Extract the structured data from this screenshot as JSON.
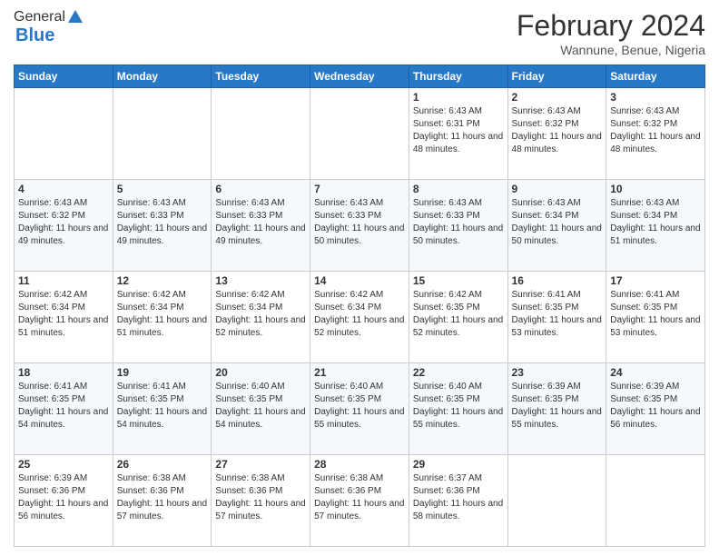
{
  "logo": {
    "general": "General",
    "blue": "Blue"
  },
  "header": {
    "title": "February 2024",
    "subtitle": "Wannune, Benue, Nigeria"
  },
  "days_of_week": [
    "Sunday",
    "Monday",
    "Tuesday",
    "Wednesday",
    "Thursday",
    "Friday",
    "Saturday"
  ],
  "weeks": [
    [
      {
        "day": "",
        "info": ""
      },
      {
        "day": "",
        "info": ""
      },
      {
        "day": "",
        "info": ""
      },
      {
        "day": "",
        "info": ""
      },
      {
        "day": "1",
        "info": "Sunrise: 6:43 AM\nSunset: 6:31 PM\nDaylight: 11 hours and 48 minutes."
      },
      {
        "day": "2",
        "info": "Sunrise: 6:43 AM\nSunset: 6:32 PM\nDaylight: 11 hours and 48 minutes."
      },
      {
        "day": "3",
        "info": "Sunrise: 6:43 AM\nSunset: 6:32 PM\nDaylight: 11 hours and 48 minutes."
      }
    ],
    [
      {
        "day": "4",
        "info": "Sunrise: 6:43 AM\nSunset: 6:32 PM\nDaylight: 11 hours and 49 minutes."
      },
      {
        "day": "5",
        "info": "Sunrise: 6:43 AM\nSunset: 6:33 PM\nDaylight: 11 hours and 49 minutes."
      },
      {
        "day": "6",
        "info": "Sunrise: 6:43 AM\nSunset: 6:33 PM\nDaylight: 11 hours and 49 minutes."
      },
      {
        "day": "7",
        "info": "Sunrise: 6:43 AM\nSunset: 6:33 PM\nDaylight: 11 hours and 50 minutes."
      },
      {
        "day": "8",
        "info": "Sunrise: 6:43 AM\nSunset: 6:33 PM\nDaylight: 11 hours and 50 minutes."
      },
      {
        "day": "9",
        "info": "Sunrise: 6:43 AM\nSunset: 6:34 PM\nDaylight: 11 hours and 50 minutes."
      },
      {
        "day": "10",
        "info": "Sunrise: 6:43 AM\nSunset: 6:34 PM\nDaylight: 11 hours and 51 minutes."
      }
    ],
    [
      {
        "day": "11",
        "info": "Sunrise: 6:42 AM\nSunset: 6:34 PM\nDaylight: 11 hours and 51 minutes."
      },
      {
        "day": "12",
        "info": "Sunrise: 6:42 AM\nSunset: 6:34 PM\nDaylight: 11 hours and 51 minutes."
      },
      {
        "day": "13",
        "info": "Sunrise: 6:42 AM\nSunset: 6:34 PM\nDaylight: 11 hours and 52 minutes."
      },
      {
        "day": "14",
        "info": "Sunrise: 6:42 AM\nSunset: 6:34 PM\nDaylight: 11 hours and 52 minutes."
      },
      {
        "day": "15",
        "info": "Sunrise: 6:42 AM\nSunset: 6:35 PM\nDaylight: 11 hours and 52 minutes."
      },
      {
        "day": "16",
        "info": "Sunrise: 6:41 AM\nSunset: 6:35 PM\nDaylight: 11 hours and 53 minutes."
      },
      {
        "day": "17",
        "info": "Sunrise: 6:41 AM\nSunset: 6:35 PM\nDaylight: 11 hours and 53 minutes."
      }
    ],
    [
      {
        "day": "18",
        "info": "Sunrise: 6:41 AM\nSunset: 6:35 PM\nDaylight: 11 hours and 54 minutes."
      },
      {
        "day": "19",
        "info": "Sunrise: 6:41 AM\nSunset: 6:35 PM\nDaylight: 11 hours and 54 minutes."
      },
      {
        "day": "20",
        "info": "Sunrise: 6:40 AM\nSunset: 6:35 PM\nDaylight: 11 hours and 54 minutes."
      },
      {
        "day": "21",
        "info": "Sunrise: 6:40 AM\nSunset: 6:35 PM\nDaylight: 11 hours and 55 minutes."
      },
      {
        "day": "22",
        "info": "Sunrise: 6:40 AM\nSunset: 6:35 PM\nDaylight: 11 hours and 55 minutes."
      },
      {
        "day": "23",
        "info": "Sunrise: 6:39 AM\nSunset: 6:35 PM\nDaylight: 11 hours and 55 minutes."
      },
      {
        "day": "24",
        "info": "Sunrise: 6:39 AM\nSunset: 6:35 PM\nDaylight: 11 hours and 56 minutes."
      }
    ],
    [
      {
        "day": "25",
        "info": "Sunrise: 6:39 AM\nSunset: 6:36 PM\nDaylight: 11 hours and 56 minutes."
      },
      {
        "day": "26",
        "info": "Sunrise: 6:38 AM\nSunset: 6:36 PM\nDaylight: 11 hours and 57 minutes."
      },
      {
        "day": "27",
        "info": "Sunrise: 6:38 AM\nSunset: 6:36 PM\nDaylight: 11 hours and 57 minutes."
      },
      {
        "day": "28",
        "info": "Sunrise: 6:38 AM\nSunset: 6:36 PM\nDaylight: 11 hours and 57 minutes."
      },
      {
        "day": "29",
        "info": "Sunrise: 6:37 AM\nSunset: 6:36 PM\nDaylight: 11 hours and 58 minutes."
      },
      {
        "day": "",
        "info": ""
      },
      {
        "day": "",
        "info": ""
      }
    ]
  ]
}
